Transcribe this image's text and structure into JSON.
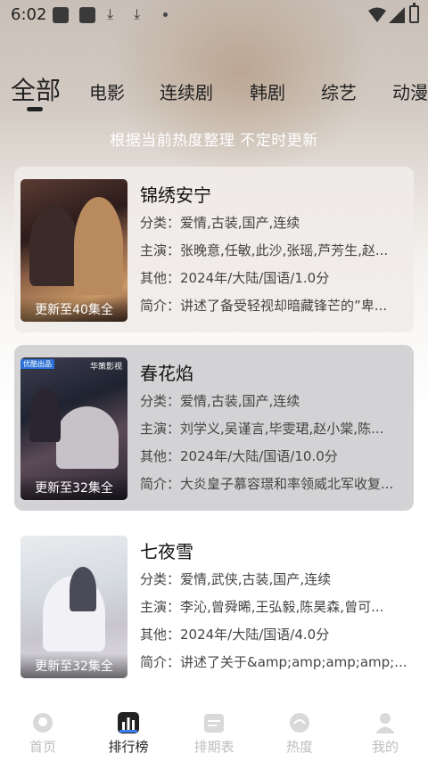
{
  "status_bar": {
    "time": "6:02"
  },
  "tabs": [
    {
      "label": "全部",
      "active": true
    },
    {
      "label": "电影"
    },
    {
      "label": "连续剧"
    },
    {
      "label": "韩剧"
    },
    {
      "label": "综艺"
    },
    {
      "label": "动漫"
    }
  ],
  "subtitle": "根据当前热度整理 不定时更新",
  "cards": [
    {
      "title": "锦绣安宁",
      "badge": "更新至40集全",
      "genre": "分类：爱情,古装,国产,连续",
      "cast": "主演：张晚意,任敏,此沙,张瑶,芦芳生,赵...",
      "other": "其他：2024年/大陆/国语/1.0分",
      "summary": "简介：讲述了备受轻视却暗藏锋芒的”卑..."
    },
    {
      "title": "春花焰",
      "badge": "更新至32集全",
      "tag": "优酷出品",
      "logo": "华策影视",
      "genre": "分类：爱情,古装,国产,连续",
      "cast": "主演：刘学义,吴谨言,毕雯珺,赵小棠,陈...",
      "other": "其他：2024年/大陆/国语/10.0分",
      "summary": "简介：大炎皇子慕容璟和率领威北军收复..."
    },
    {
      "title": "七夜雪",
      "badge": "更新至32集全",
      "genre": "分类：爱情,武侠,古装,国产,连续",
      "cast": "主演：李沁,曾舜晞,王弘毅,陈昊森,曾可...",
      "other": "其他：2024年/大陆/国语/4.0分",
      "summary": "简介：讲述了关于&amp;amp;amp;amp;..."
    }
  ],
  "bottom_nav": [
    {
      "label": "首页",
      "icon": "home-icon"
    },
    {
      "label": "排行榜",
      "icon": "ranking-icon",
      "active": true
    },
    {
      "label": "排期表",
      "icon": "calendar-icon"
    },
    {
      "label": "热度",
      "icon": "heat-icon"
    },
    {
      "label": "我的",
      "icon": "profile-icon"
    }
  ],
  "colors": {
    "active_tab": "#222222",
    "inactive_nav": "#bdbdbd",
    "card2_bg": "#d3d3d5"
  }
}
